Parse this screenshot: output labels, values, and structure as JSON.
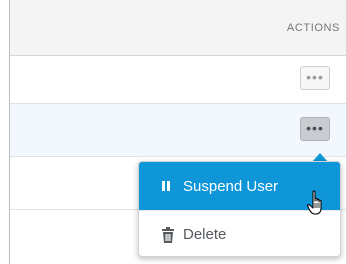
{
  "table": {
    "header_actions_label": "ACTIONS",
    "more_button_label": "•••"
  },
  "action_menu": {
    "items": [
      {
        "label": "Suspend User",
        "icon": "pause-icon"
      },
      {
        "label": "Delete",
        "icon": "trash-icon"
      }
    ],
    "highlight_color": "#0e96d8"
  },
  "cursor": {
    "icon": "hand-pointer-icon"
  }
}
